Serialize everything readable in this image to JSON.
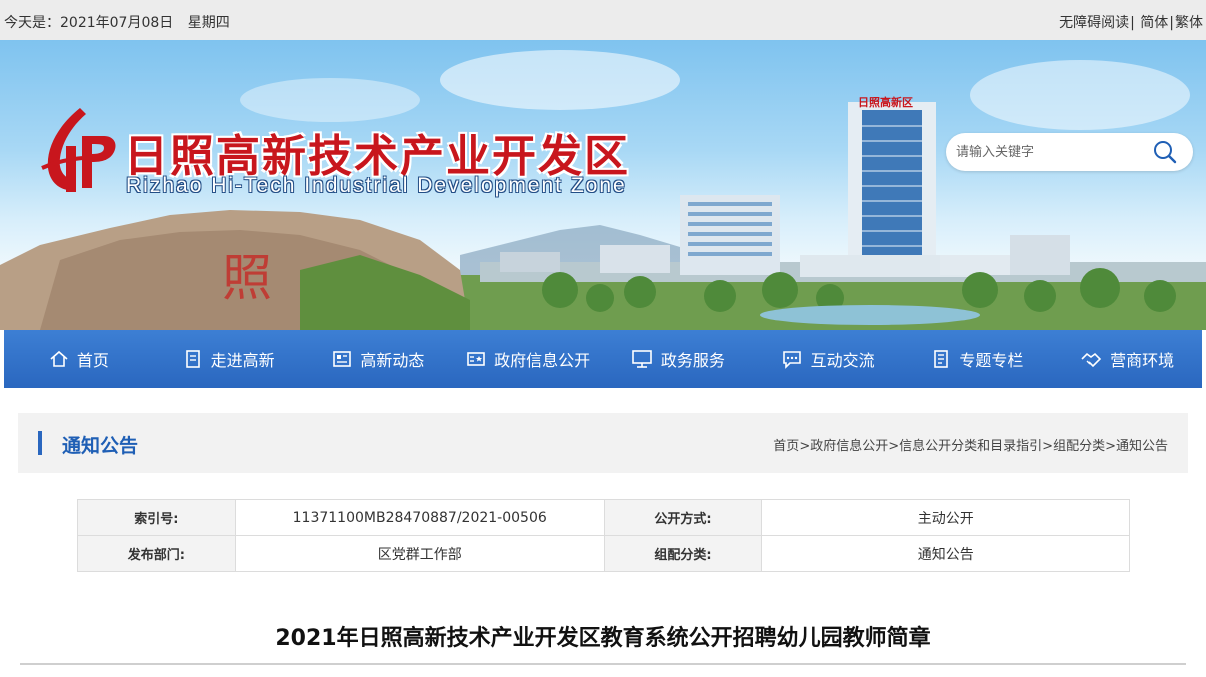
{
  "topbar": {
    "date_prefix": "今天是：",
    "date": "2021年07月08日",
    "weekday": "星期四",
    "accessible": "无障碍阅读",
    "simplified": "简体",
    "traditional": "繁体"
  },
  "banner": {
    "title": "日照高新技术产业开发区",
    "subtitle": "Rizhao Hi-Tech Industrial Development Zone",
    "building_sign": "日照高新区",
    "search_placeholder": "请输入关键字"
  },
  "nav": [
    {
      "label": "首页",
      "icon": "home-icon"
    },
    {
      "label": "走进高新",
      "icon": "document-icon"
    },
    {
      "label": "高新动态",
      "icon": "news-icon"
    },
    {
      "label": "政府信息公开",
      "icon": "gov-info-icon"
    },
    {
      "label": "政务服务",
      "icon": "monitor-icon"
    },
    {
      "label": "互动交流",
      "icon": "chat-icon"
    },
    {
      "label": "专题专栏",
      "icon": "list-icon"
    },
    {
      "label": "营商环境",
      "icon": "handshake-icon"
    }
  ],
  "section": {
    "title": "通知公告",
    "breadcrumb": [
      "首页",
      "政府信息公开",
      "信息公开分类和目录指引",
      "组配分类",
      "通知公告"
    ],
    "separator": ">"
  },
  "info": {
    "index_label": "索引号:",
    "index_value": "11371100MB28470887/2021-00506",
    "open_label": "公开方式:",
    "open_value": "主动公开",
    "dept_label": "发布部门:",
    "dept_value": "区党群工作部",
    "category_label": "组配分类:",
    "category_value": "通知公告"
  },
  "article": {
    "title": "2021年日照高新技术产业开发区教育系统公开招聘幼儿园教师简章"
  },
  "colors": {
    "nav_blue": "#2a67bf",
    "logo_red": "#c8161d"
  }
}
